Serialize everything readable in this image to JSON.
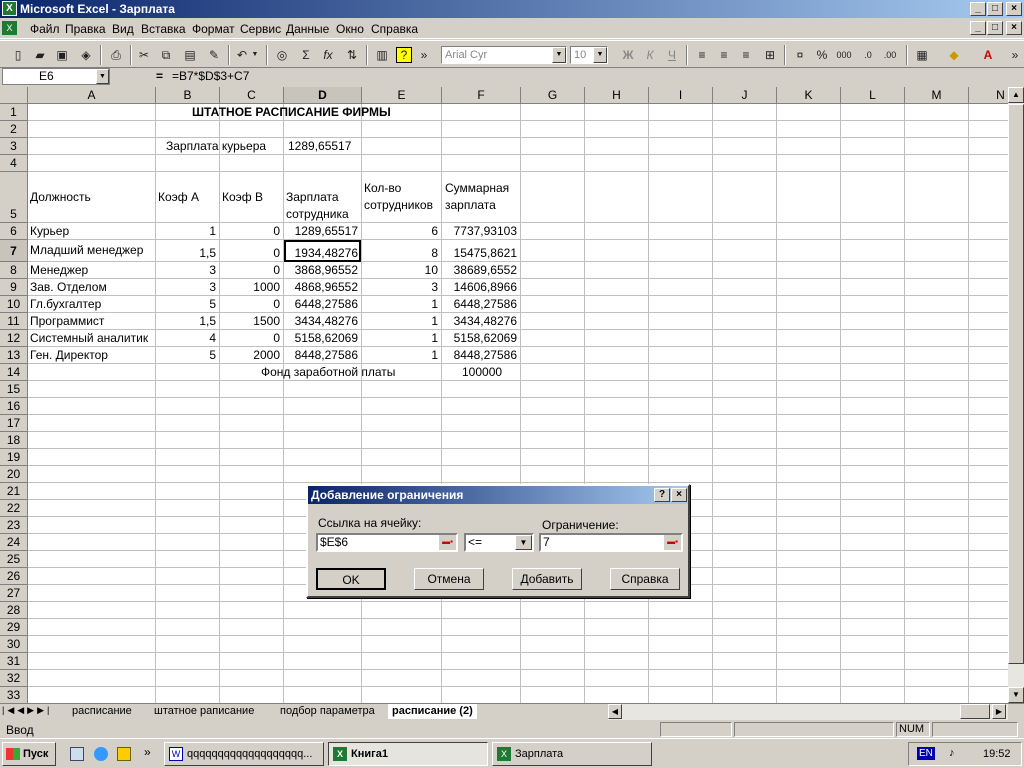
{
  "window": {
    "title": "Microsoft Excel - Зарплата",
    "app_icon": "excel-icon"
  },
  "menu": [
    "Файл",
    "Правка",
    "Вид",
    "Вставка",
    "Формат",
    "Сервис",
    "Данные",
    "Окно",
    "Справка"
  ],
  "toolbar": {
    "font": "Arial Cyr",
    "size": "10"
  },
  "formula_bar": {
    "name_box": "E6",
    "eq": "=",
    "formula": "=B7*$D$3+C7"
  },
  "columns": [
    "A",
    "B",
    "C",
    "D",
    "E",
    "F",
    "G",
    "H",
    "I",
    "J",
    "K",
    "L",
    "M",
    "N"
  ],
  "rows": [
    "1",
    "2",
    "3",
    "4",
    "5",
    "6",
    "7",
    "8",
    "9",
    "10",
    "11",
    "12",
    "13",
    "14",
    "15",
    "16",
    "17",
    "18",
    "19",
    "20",
    "21",
    "22",
    "23",
    "24",
    "25",
    "26",
    "27",
    "28",
    "29",
    "30",
    "31",
    "32",
    "33"
  ],
  "sheet": {
    "title": "ШТАТНОЕ РАСПИСАНИЕ ФИРМЫ",
    "courier_label": "Зарплата курьера",
    "courier_value": "1289,65517",
    "headers": {
      "a": "Должность",
      "b": "Коэф А",
      "c": "Коэф В",
      "d1": "Зарплата",
      "d2": "сотрудника",
      "e1": "Кол-во",
      "e2": "сотрудников",
      "f1": "Суммарная",
      "f2": "зарплата"
    },
    "data": [
      [
        "Курьер",
        "1",
        "0",
        "1289,65517",
        "6",
        "7737,93103"
      ],
      [
        "Младший менеджер",
        "1,5",
        "0",
        "1934,48276",
        "8",
        "15475,8621"
      ],
      [
        "Менеджер",
        "3",
        "0",
        "3868,96552",
        "10",
        "38689,6552"
      ],
      [
        "Зав. Отделом",
        "3",
        "1000",
        "4868,96552",
        "3",
        "14606,8966"
      ],
      [
        "Гл.бухгалтер",
        "5",
        "0",
        "6448,27586",
        "1",
        "6448,27586"
      ],
      [
        "Программист",
        "1,5",
        "1500",
        "3434,48276",
        "1",
        "3434,48276"
      ],
      [
        "Системный аналитик",
        "4",
        "0",
        "5158,62069",
        "1",
        "5158,62069"
      ],
      [
        "Ген. Директор",
        "5",
        "2000",
        "8448,27586",
        "1",
        "8448,27586"
      ]
    ],
    "fund_label": "Фонд заработной платы",
    "fund_value": "100000"
  },
  "tabs": [
    "расписание",
    "штатное раписание",
    "подбор параметра",
    "расписание (2)"
  ],
  "active_tab": "расписание (2)",
  "status": {
    "mode": "Ввод",
    "num": "NUM"
  },
  "dialog": {
    "title": "Добавление ограничения",
    "cell_ref_label": "Ссылка на ячейку:",
    "cell_ref_value": "$E$6",
    "operator": "<=",
    "constraint_label": "Ограничение:",
    "constraint_value": "7",
    "ok": "OK",
    "cancel": "Отмена",
    "add": "Добавить",
    "help": "Справка"
  },
  "taskbar": {
    "start": "Пуск",
    "items": [
      "qqqqqqqqqqqqqqqqqqq...",
      "Книга1",
      "Зарплата"
    ],
    "lang": "EN",
    "time": "19:52"
  }
}
